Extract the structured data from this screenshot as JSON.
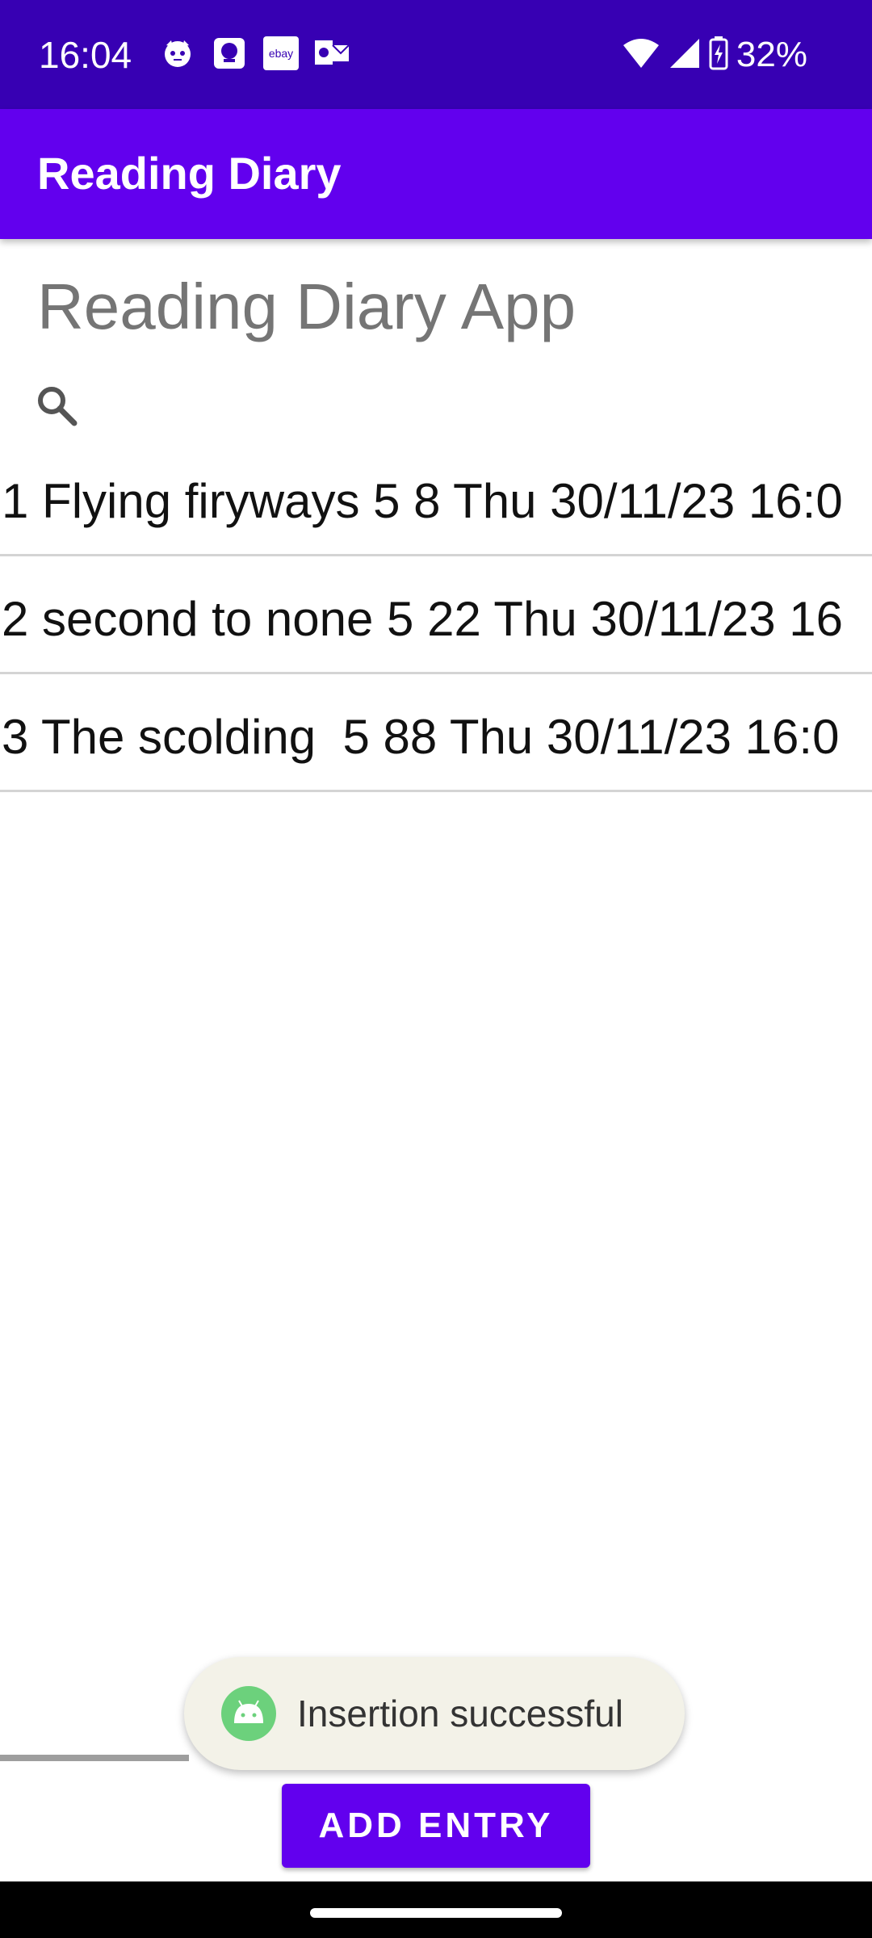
{
  "status_bar": {
    "time": "16:04",
    "battery": "32%",
    "notification_icons": [
      "cat-face-icon",
      "chat-bubble-icon",
      "ebay-icon",
      "outlook-icon"
    ],
    "color": "#3700b3"
  },
  "app_bar": {
    "title": "Reading Diary",
    "color": "#6200ee"
  },
  "main": {
    "heading": "Reading Diary App",
    "search_icon": "search-icon",
    "entries": [
      {
        "text": "1 Flying firyways 5 8 Thu 30/11/23 16:0"
      },
      {
        "text": "2 second to none 5 22 Thu 30/11/23 16"
      },
      {
        "text": "3 The scolding  5 88 Thu 30/11/23 16:0"
      }
    ]
  },
  "toast": {
    "message": "Insertion successful",
    "icon": "android-icon"
  },
  "actions": {
    "add_entry_label": "ADD ENTRY"
  }
}
